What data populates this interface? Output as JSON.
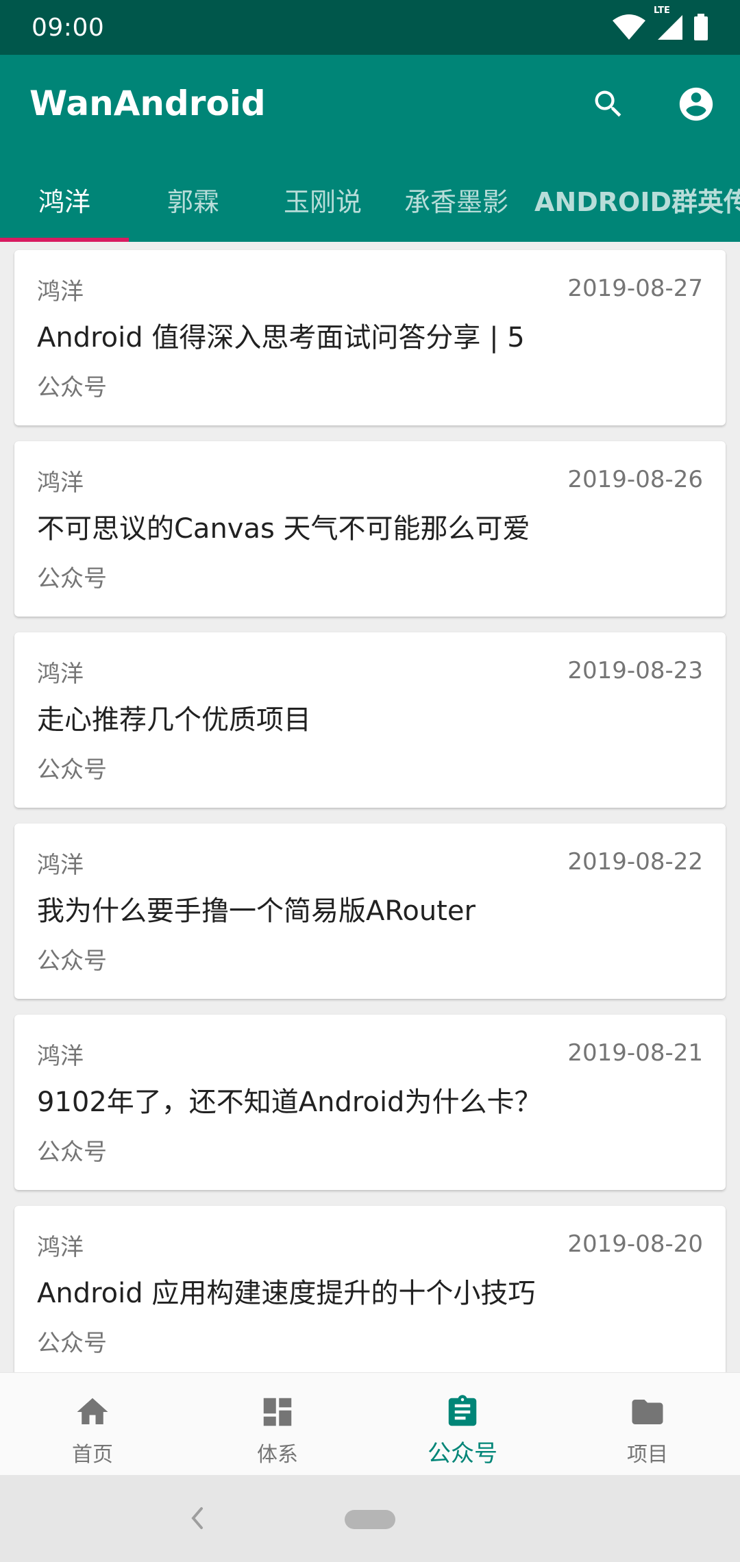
{
  "status_bar": {
    "time": "09:00",
    "network_label": "LTE"
  },
  "app_bar": {
    "title": "WanAndroid",
    "tabs": [
      {
        "label": "鸿洋",
        "active": true
      },
      {
        "label": "郭霖",
        "active": false
      },
      {
        "label": "玉刚说",
        "active": false
      },
      {
        "label": "承香墨影",
        "active": false
      },
      {
        "label": "ANDROID群英传",
        "active": false
      }
    ]
  },
  "articles": [
    {
      "author": "鸿洋",
      "date": "2019-08-27",
      "title": "Android 值得深入思考面试问答分享 | 5",
      "chapter": "公众号"
    },
    {
      "author": "鸿洋",
      "date": "2019-08-26",
      "title": "不可思议的Canvas 天气不可能那么可爱",
      "chapter": "公众号"
    },
    {
      "author": "鸿洋",
      "date": "2019-08-23",
      "title": "走心推荐几个优质项目",
      "chapter": "公众号"
    },
    {
      "author": "鸿洋",
      "date": "2019-08-22",
      "title": "我为什么要手撸一个简易版ARouter",
      "chapter": "公众号"
    },
    {
      "author": "鸿洋",
      "date": "2019-08-21",
      "title": "9102年了，还不知道Android为什么卡？",
      "chapter": "公众号"
    },
    {
      "author": "鸿洋",
      "date": "2019-08-20",
      "title": "Android 应用构建速度提升的十个小技巧",
      "chapter": "公众号"
    }
  ],
  "bottom_nav": [
    {
      "label": "首页",
      "icon": "home-icon",
      "active": false
    },
    {
      "label": "体系",
      "icon": "dashboard-icon",
      "active": false
    },
    {
      "label": "公众号",
      "icon": "assignment-icon",
      "active": true
    },
    {
      "label": "项目",
      "icon": "folder-icon",
      "active": false
    }
  ],
  "colors": {
    "primary": "#008577",
    "primary_dark": "#00574b",
    "accent": "#d81b60"
  }
}
